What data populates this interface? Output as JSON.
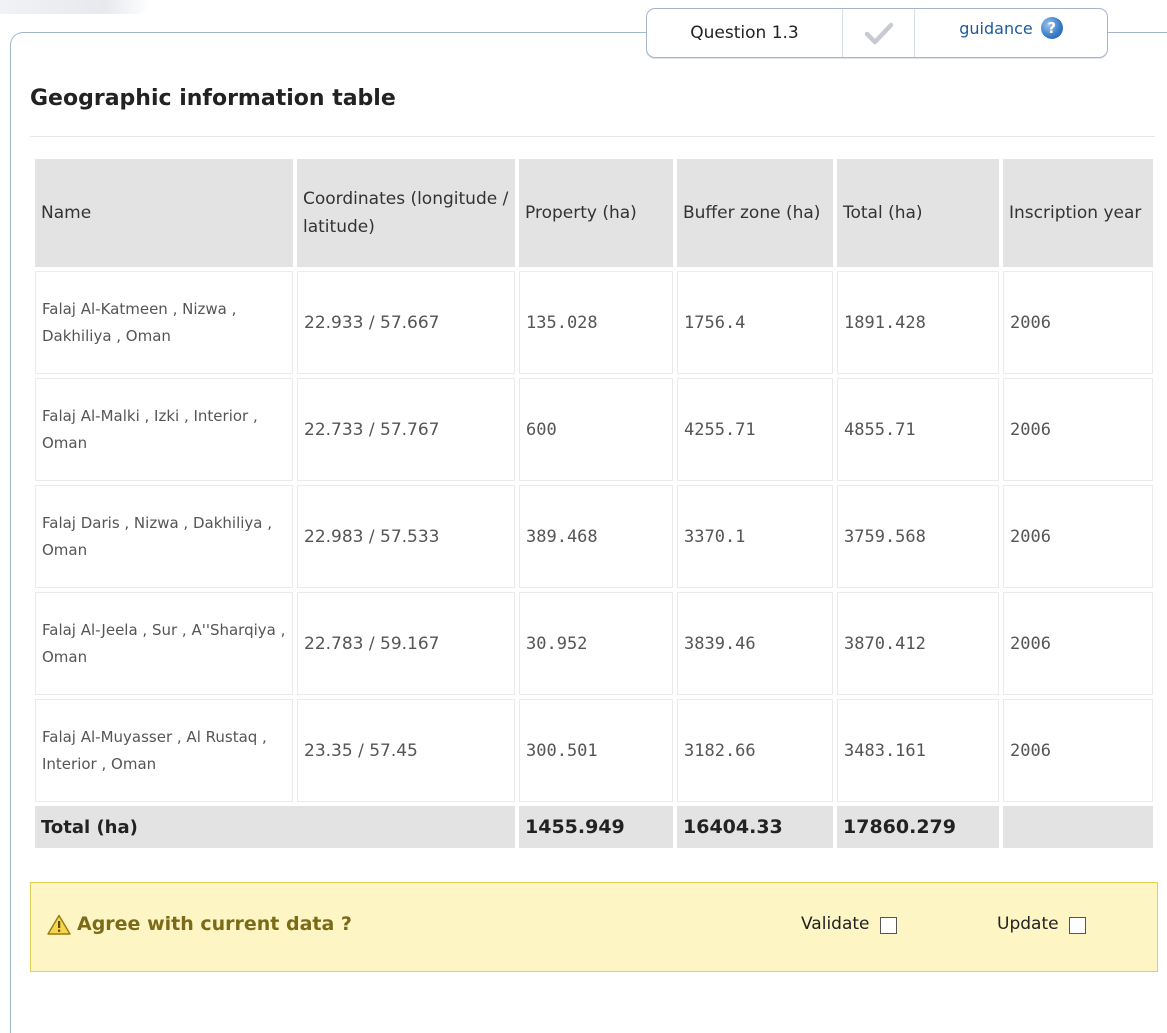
{
  "header": {
    "question_label": "Question 1.3",
    "check_icon": "checkmark-icon",
    "guidance_label": "guidance",
    "guidance_icon": "help-circle-icon"
  },
  "title": "Geographic information table",
  "table": {
    "columns": [
      "Name",
      "Coordinates (longitude / latitude)",
      "Property (ha)",
      "Buffer zone (ha)",
      "Total (ha)",
      "Inscription year"
    ],
    "rows": [
      {
        "name": "Falaj Al-Katmeen , Nizwa , Dakhiliya , Oman",
        "coordinates": "22.933 / 57.667",
        "property": "135.028",
        "buffer": "1756.4",
        "total": "1891.428",
        "year": "2006"
      },
      {
        "name": "Falaj Al-Malki , Izki , Interior , Oman",
        "coordinates": "22.733 / 57.767",
        "property": "600",
        "buffer": "4255.71",
        "total": "4855.71",
        "year": "2006"
      },
      {
        "name": "Falaj Daris , Nizwa , Dakhiliya , Oman",
        "coordinates": "22.983 / 57.533",
        "property": "389.468",
        "buffer": "3370.1",
        "total": "3759.568",
        "year": "2006"
      },
      {
        "name": "Falaj Al-Jeela , Sur , A''Sharqiya , Oman",
        "coordinates": "22.783 / 59.167",
        "property": "30.952",
        "buffer": "3839.46",
        "total": "3870.412",
        "year": "2006"
      },
      {
        "name": "Falaj Al-Muyasser , Al Rustaq , Interior , Oman",
        "coordinates": "23.35 / 57.45",
        "property": "300.501",
        "buffer": "3182.66",
        "total": "3483.161",
        "year": "2006"
      }
    ],
    "total_row": {
      "label": "Total (ha)",
      "property": "1455.949",
      "buffer": "16404.33",
      "total": "17860.279",
      "year": ""
    }
  },
  "agreement": {
    "prompt": "Agree with current data ?",
    "warning_icon": "warning-triangle-icon",
    "validate_label": "Validate",
    "update_label": "Update",
    "validate_checked": false,
    "update_checked": false
  },
  "colors": {
    "panel_border": "#a3b6cc",
    "header_cell": "#e3e3e3",
    "agree_background": "#fdf6c4",
    "agree_border": "#e4cf56",
    "link": "#1c5a9e"
  }
}
